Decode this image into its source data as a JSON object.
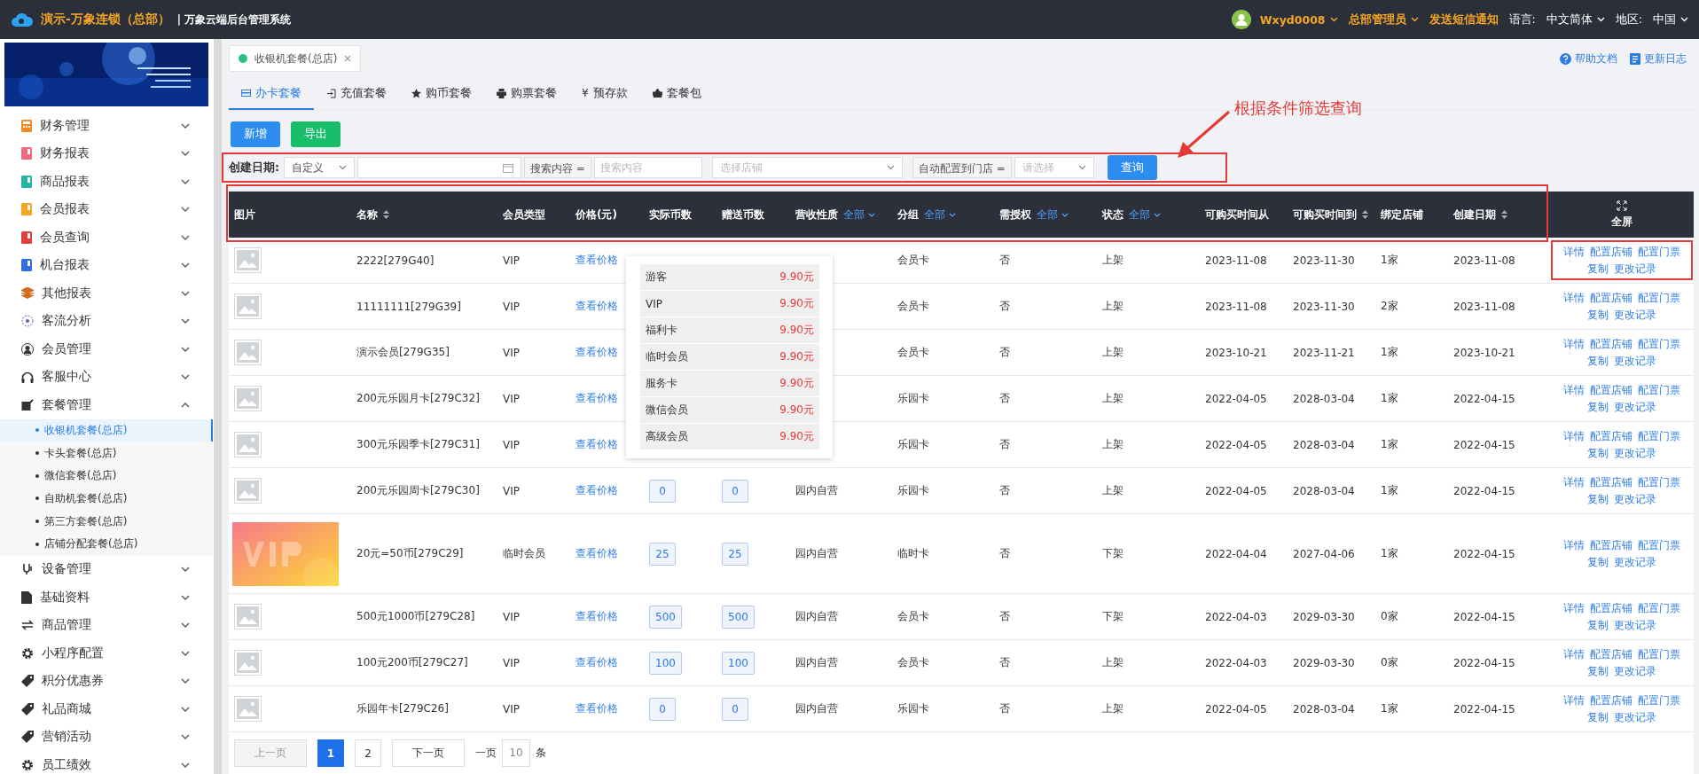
{
  "header": {
    "title": "演示-万象连锁（总部）",
    "system": "| 万象云端后台管理系统",
    "user": "Wxyd0008",
    "role": "总部管理员",
    "notify": "发送短信通知",
    "language_label": "语言:",
    "language": "中文简体",
    "region_label": "地区:",
    "region": "中国"
  },
  "sidebar": {
    "items": [
      {
        "label": "财务管理",
        "expanded": false
      },
      {
        "label": "财务报表",
        "expanded": false
      },
      {
        "label": "商品报表",
        "expanded": false
      },
      {
        "label": "会员报表",
        "expanded": false
      },
      {
        "label": "会员查询",
        "expanded": false
      },
      {
        "label": "机台报表",
        "expanded": false
      },
      {
        "label": "其他报表",
        "expanded": false
      },
      {
        "label": "客流分析",
        "expanded": false
      },
      {
        "label": "会员管理",
        "expanded": false
      },
      {
        "label": "客服中心",
        "expanded": false
      },
      {
        "label": "套餐管理",
        "expanded": true,
        "children": [
          {
            "label": "收银机套餐(总店)",
            "selected": true
          },
          {
            "label": "卡头套餐(总店)",
            "selected": false
          },
          {
            "label": "微信套餐(总店)",
            "selected": false
          },
          {
            "label": "自助机套餐(总店)",
            "selected": false
          },
          {
            "label": "第三方套餐(总店)",
            "selected": false
          },
          {
            "label": "店铺分配套餐(总店)",
            "selected": false
          }
        ]
      },
      {
        "label": "设备管理",
        "expanded": false
      },
      {
        "label": "基础资料",
        "expanded": false
      },
      {
        "label": "商品管理",
        "expanded": false
      },
      {
        "label": "小程序配置",
        "expanded": false
      },
      {
        "label": "积分优惠券",
        "expanded": false
      },
      {
        "label": "礼品商城",
        "expanded": false
      },
      {
        "label": "营销活动",
        "expanded": false
      },
      {
        "label": "员工绩效",
        "expanded": false
      }
    ]
  },
  "open_tabs": [
    {
      "label": "收银机套餐(总店)",
      "selected": true
    }
  ],
  "help_links": [
    "帮助文档",
    "更新日志"
  ],
  "sub_tabs": [
    {
      "label": "办卡套餐",
      "selected": true
    },
    {
      "label": "充值套餐",
      "selected": false
    },
    {
      "label": "购币套餐",
      "selected": false
    },
    {
      "label": "购票套餐",
      "selected": false
    },
    {
      "label": "预存款",
      "selected": false,
      "symbol": "¥"
    },
    {
      "label": "套餐包",
      "selected": false
    }
  ],
  "buttons": [
    {
      "label": "新增",
      "kind": "primary"
    },
    {
      "label": "导出",
      "kind": "success"
    }
  ],
  "filters": {
    "highlighted": true,
    "date_label": "创建日期:",
    "date_mode": "自定义",
    "search_label": "搜索内容 =",
    "search_placeholder": "搜索内容",
    "store_placeholder": "选择店铺",
    "auto_label": "自动配置到门店 =",
    "auto_placeholder": "请选择",
    "query_button": "查询"
  },
  "annotation": "根据条件筛选查询",
  "table": {
    "header_highlighted": true,
    "columns": [
      {
        "label": "图片",
        "sortable": false
      },
      {
        "label": "名称",
        "sortable": true
      },
      {
        "label": "会员类型",
        "sortable": false
      },
      {
        "label": "价格(元)",
        "sortable": false
      },
      {
        "label": "实际币数",
        "sortable": false
      },
      {
        "label": "赠送币数",
        "sortable": false
      },
      {
        "label": "营收性质",
        "sortable": false,
        "filter": "全部"
      },
      {
        "label": "分组",
        "sortable": false,
        "filter": "全部"
      },
      {
        "label": "需授权",
        "sortable": false,
        "filter": "全部"
      },
      {
        "label": "状态",
        "sortable": false,
        "filter": "全部"
      },
      {
        "label": "可购买时间从",
        "sortable": false
      },
      {
        "label": "可购买时间到",
        "sortable": true
      },
      {
        "label": "绑定店铺",
        "sortable": false
      },
      {
        "label": "创建日期",
        "sortable": true
      },
      {
        "label": "全屏",
        "sortable": false
      }
    ],
    "rows": [
      {
        "kind": "placeholder",
        "name": "2222[279G40]",
        "member_type": "VIP",
        "price": "查看价格",
        "group": "会员卡",
        "auth": "否",
        "status": "上架",
        "from": "2023-11-08",
        "to": "2023-11-30",
        "stores": "1家",
        "created": "2023-11-08",
        "actions_highlighted": true,
        "actions": [
          "详情",
          "配置店铺",
          "配置门票",
          "复制",
          "更改记录"
        ]
      },
      {
        "kind": "placeholder",
        "name": "11111111[279G39]",
        "member_type": "VIP",
        "price": "查看价格",
        "group": "会员卡",
        "auth": "否",
        "status": "上架",
        "from": "2023-11-08",
        "to": "2023-11-30",
        "stores": "2家",
        "created": "2023-11-08",
        "actions_highlighted": false,
        "actions": [
          "详情",
          "配置店铺",
          "配置门票",
          "复制",
          "更改记录"
        ]
      },
      {
        "kind": "placeholder",
        "name": "演示会员[279G35]",
        "member_type": "VIP",
        "price": "查看价格",
        "group": "会员卡",
        "auth": "否",
        "status": "上架",
        "from": "2023-10-21",
        "to": "2023-11-21",
        "stores": "1家",
        "created": "2023-10-21",
        "actions_highlighted": false,
        "actions": [
          "详情",
          "配置店铺",
          "配置门票",
          "复制",
          "更改记录"
        ]
      },
      {
        "kind": "placeholder",
        "name": "200元乐园月卡[279C32]",
        "member_type": "VIP",
        "price": "查看价格",
        "group": "乐园卡",
        "auth": "否",
        "status": "上架",
        "from": "2022-04-05",
        "to": "2028-03-04",
        "stores": "1家",
        "created": "2022-04-15",
        "actions_highlighted": false,
        "actions": [
          "详情",
          "配置店铺",
          "配置门票",
          "复制",
          "更改记录"
        ]
      },
      {
        "kind": "placeholder",
        "name": "300元乐园季卡[279C31]",
        "member_type": "VIP",
        "price": "查看价格",
        "group": "乐园卡",
        "auth": "否",
        "status": "上架",
        "from": "2022-04-05",
        "to": "2028-03-04",
        "stores": "1家",
        "created": "2022-04-15",
        "actions_highlighted": false,
        "actions": [
          "详情",
          "配置店铺",
          "配置门票",
          "复制",
          "更改记录"
        ]
      },
      {
        "kind": "placeholder",
        "name": "200元乐园周卡[279C30]",
        "member_type": "VIP",
        "price": "查看价格",
        "coins": "0",
        "bonus": "0",
        "revenue": "园内自营",
        "group": "乐园卡",
        "auth": "否",
        "status": "上架",
        "from": "2022-04-05",
        "to": "2028-03-04",
        "stores": "1家",
        "created": "2022-04-15",
        "actions_highlighted": false,
        "actions": [
          "详情",
          "配置店铺",
          "配置门票",
          "复制",
          "更改记录"
        ]
      },
      {
        "kind": "picture",
        "name": "20元=50币[279C29]",
        "member_type": "临时会员",
        "price": "查看价格",
        "coins": "25",
        "bonus": "25",
        "revenue": "园内自营",
        "group": "临时卡",
        "auth": "否",
        "status": "下架",
        "from": "2022-04-04",
        "to": "2027-04-06",
        "stores": "1家",
        "created": "2022-04-15",
        "actions_highlighted": false,
        "actions": [
          "详情",
          "配置店铺",
          "配置门票",
          "复制",
          "更改记录"
        ]
      },
      {
        "kind": "placeholder",
        "name": "500元1000币[279C28]",
        "member_type": "VIP",
        "price": "查看价格",
        "coins": "500",
        "bonus": "500",
        "revenue": "园内自营",
        "group": "会员卡",
        "auth": "否",
        "status": "下架",
        "from": "2022-04-03",
        "to": "2029-03-30",
        "stores": "0家",
        "created": "2022-04-15",
        "actions_highlighted": false,
        "actions": [
          "详情",
          "配置店铺",
          "配置门票",
          "复制",
          "更改记录"
        ]
      },
      {
        "kind": "placeholder",
        "name": "100元200币[279C27]",
        "member_type": "VIP",
        "price": "查看价格",
        "coins": "100",
        "bonus": "100",
        "revenue": "园内自营",
        "group": "会员卡",
        "auth": "否",
        "status": "上架",
        "from": "2022-04-03",
        "to": "2029-03-30",
        "stores": "0家",
        "created": "2022-04-15",
        "actions_highlighted": false,
        "actions": [
          "详情",
          "配置店铺",
          "配置门票",
          "复制",
          "更改记录"
        ]
      },
      {
        "kind": "placeholder",
        "name": "乐园年卡[279C26]",
        "member_type": "VIP",
        "price": "查看价格",
        "coins": "0",
        "bonus": "0",
        "revenue": "园内自营",
        "group": "乐园卡",
        "auth": "否",
        "status": "上架",
        "from": "2022-04-05",
        "to": "2028-03-04",
        "stores": "1家",
        "created": "2022-04-15",
        "actions_highlighted": false,
        "actions": [
          "详情",
          "配置店铺",
          "配置门票",
          "复制",
          "更改记录"
        ]
      }
    ]
  },
  "price_popup": {
    "items": [
      {
        "label": "游客",
        "price": "9.90元"
      },
      {
        "label": "VIP",
        "price": "9.90元"
      },
      {
        "label": "福利卡",
        "price": "9.90元"
      },
      {
        "label": "临时会员",
        "price": "9.90元"
      },
      {
        "label": "服务卡",
        "price": "9.90元"
      },
      {
        "label": "微信会员",
        "price": "9.90元"
      },
      {
        "label": "高级会员",
        "price": "9.90元"
      }
    ]
  },
  "pagination": {
    "prev": "上一页",
    "pages": [
      {
        "label": "1",
        "selected": true
      },
      {
        "label": "2",
        "selected": false
      }
    ],
    "next": "下一页",
    "per_page_label": "一页",
    "per_page": "10",
    "unit": "条"
  }
}
